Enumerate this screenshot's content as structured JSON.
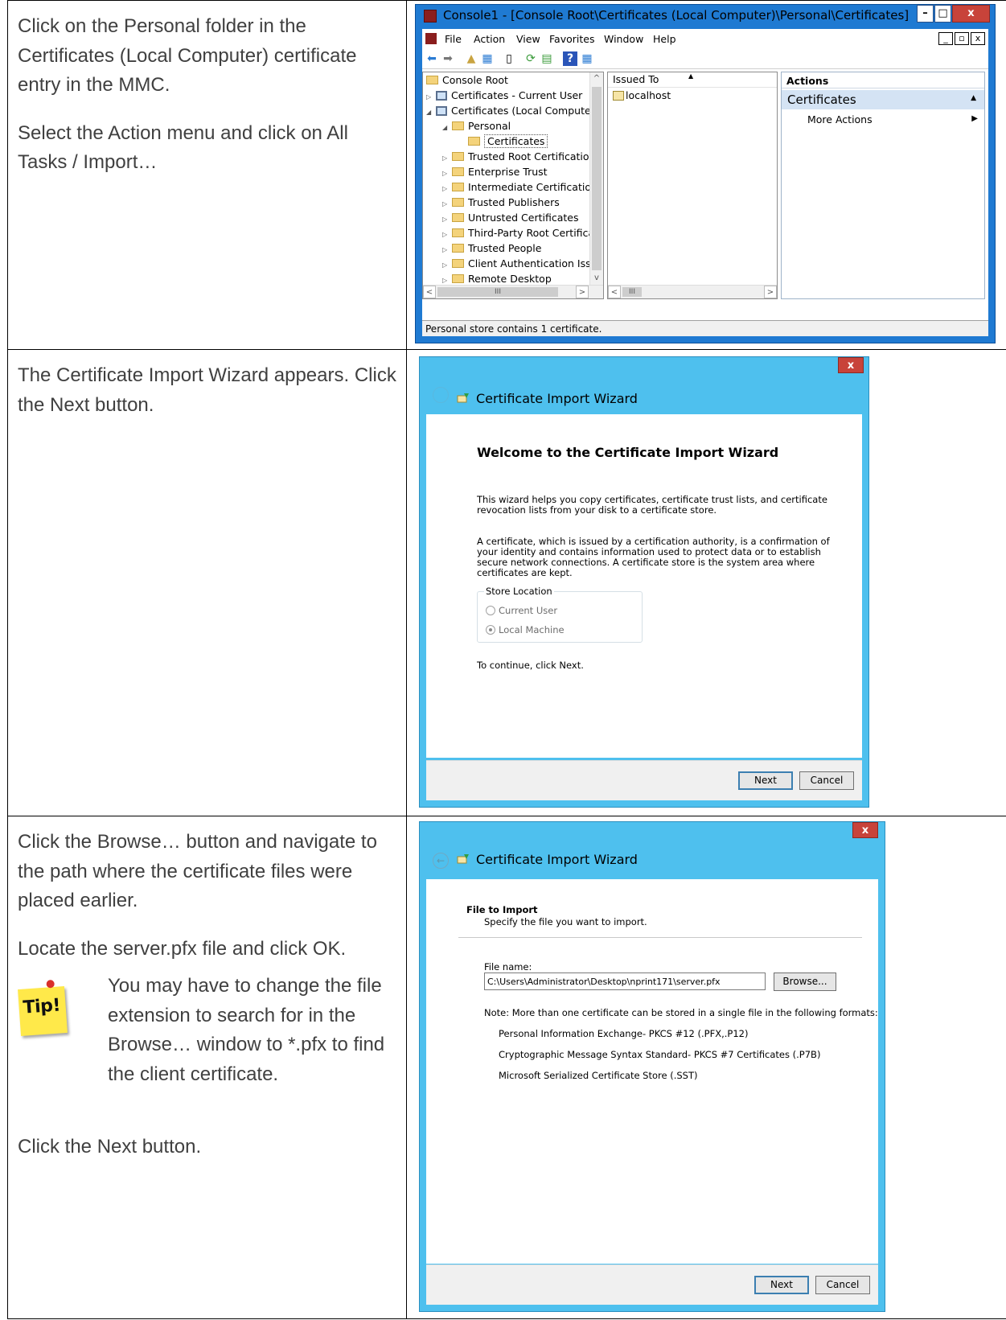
{
  "rows": [
    {
      "paragraphs": [
        "Click on the Personal folder in the Certificates (Local Computer) certificate entry in the MMC.",
        "Select the Action menu and click on All Tasks / Import…"
      ]
    },
    {
      "paragraphs": [
        "The Certificate Import Wizard appears. Click the Next button."
      ]
    },
    {
      "paragraphs": [
        "Click the Browse… button and navigate to the path where the certificate files were placed earlier.",
        "Locate the server.pfx file and click OK."
      ],
      "tip_label": "Tip!",
      "tip_text": "You may have to change the file extension to search for in the Browse… window to *.pfx to find the client certificate.",
      "after_tip": "Click the Next button."
    }
  ],
  "mmc": {
    "title": "Console1 - [Console Root\\Certificates (Local Computer)\\Personal\\Certificates]",
    "menu": [
      "File",
      "Action",
      "View",
      "Favorites",
      "Window",
      "Help"
    ],
    "tree": [
      "Console Root",
      "Certificates - Current User",
      "Certificates (Local Computer)",
      "Personal",
      "Certificates",
      "Trusted Root Certification",
      "Enterprise Trust",
      "Intermediate Certification",
      "Trusted Publishers",
      "Untrusted Certificates",
      "Third-Party Root Certifica",
      "Trusted People",
      "Client Authentication Issu",
      "Remote Desktop"
    ],
    "list_header": "Issued To",
    "list_items": [
      "localhost"
    ],
    "actions_title": "Actions",
    "actions_group": "Certificates",
    "actions_items": [
      "More Actions"
    ],
    "status": "Personal store contains 1 certificate."
  },
  "wizard1": {
    "title": "Certificate Import Wizard",
    "heading": "Welcome to the Certificate Import Wizard",
    "para1": "This wizard helps you copy certificates, certificate trust lists, and certificate revocation lists from your disk to a certificate store.",
    "para2": "A certificate, which is issued by a certification authority, is a confirmation of your identity and contains information used to protect data or to establish secure network connections. A certificate store is the system area where certificates are kept.",
    "store_label": "Store Location",
    "options": [
      "Current User",
      "Local Machine"
    ],
    "continue": "To continue, click Next.",
    "next": "Next",
    "cancel": "Cancel"
  },
  "wizard2": {
    "title": "Certificate Import Wizard",
    "section": "File to Import",
    "subtitle": "Specify the file you want to import.",
    "file_label": "File name:",
    "file_value": "C:\\Users\\Administrator\\Desktop\\nprint171\\server.pfx",
    "browse": "Browse...",
    "note": "Note:  More than one certificate can be stored in a single file in the following formats:",
    "formats": [
      "Personal Information Exchange- PKCS #12 (.PFX,.P12)",
      "Cryptographic Message Syntax Standard- PKCS #7 Certificates (.P7B)",
      "Microsoft Serialized Certificate Store (.SST)"
    ],
    "next": "Next",
    "cancel": "Cancel"
  }
}
